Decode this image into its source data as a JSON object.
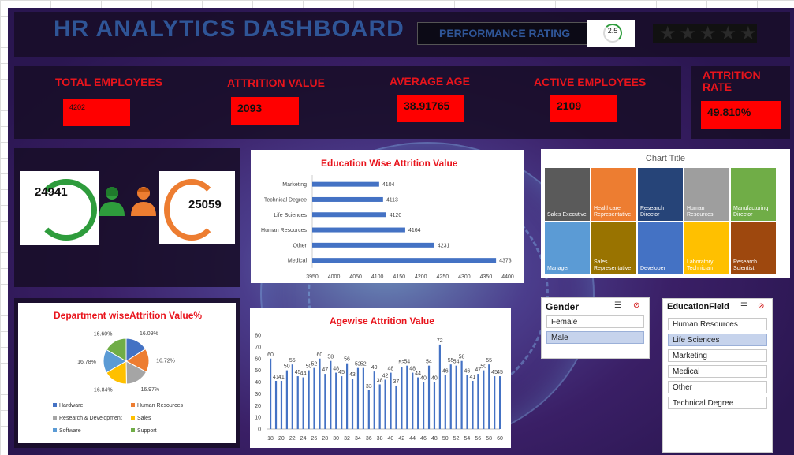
{
  "header": {
    "title": "HR  ANALYTICS   DASHBOARD",
    "performance_label": "PERFORMANCE RATING",
    "performance_value": "2.5",
    "stars": "★★★★★"
  },
  "kpis": [
    {
      "label": "TOTAL  EMPLOYEES",
      "value": "4202"
    },
    {
      "label": "ATTRITION VALUE",
      "value": "2093"
    },
    {
      "label": "AVERAGE AGE",
      "value": "38.91765"
    },
    {
      "label": "ACTIVE EMPLOYEES",
      "value": "2109"
    },
    {
      "label": "ATTRITION RATE",
      "value": "49.810%"
    }
  ],
  "gender_counts": {
    "female": "24941",
    "male": "25059"
  },
  "colors": {
    "accent_red": "#e8141c",
    "bar_blue": "#4472c4",
    "title_blue": "#2f5597",
    "green": "#2e9c3c",
    "orange": "#ed7d31"
  },
  "icons": [
    "female-person-icon",
    "male-person-icon",
    "sort-icon",
    "clear-filter-icon"
  ],
  "chart_data": [
    {
      "type": "bar",
      "orientation": "horizontal",
      "title": "Education Wise Attrition Value",
      "categories": [
        "Marketing",
        "Technical Degree",
        "Life Sciences",
        "Human Resources",
        "Other",
        "Medical"
      ],
      "values": [
        4104,
        4113,
        4120,
        4164,
        4231,
        4373
      ],
      "xlim": [
        3950,
        4400
      ],
      "xticks": [
        "3950",
        "4000",
        "4050",
        "4100",
        "4150",
        "4200",
        "4250",
        "4300",
        "4350",
        "4400"
      ]
    },
    {
      "type": "table",
      "title": "Chart Title",
      "categories": [
        "Sales Executive",
        "Healthcare Representative",
        "Research Director",
        "Human Resources",
        "Manufacturing Director",
        "Manager",
        "Sales Representative",
        "Developer",
        "Laboratory Technician",
        "Research Scientist"
      ],
      "tile_colors": [
        "#5a5a5a",
        "#ed7d31",
        "#264478",
        "#9e9e9e",
        "#70ad47",
        "#5b9bd5",
        "#997300",
        "#4472c4",
        "#ffc000",
        "#9e480e"
      ]
    },
    {
      "type": "pie",
      "title": "Department wiseAttrition Value%",
      "categories": [
        "Hardware",
        "Human Resources",
        "Research & Development",
        "Sales",
        "Software",
        "Support"
      ],
      "values": [
        16.09,
        16.72,
        16.97,
        16.84,
        16.78,
        16.6
      ],
      "labels": [
        "16.09%",
        "16.72%",
        "16.97%",
        "16.84%",
        "16.78%",
        "16.60%"
      ],
      "colors": [
        "#4472c4",
        "#ed7d31",
        "#a5a5a5",
        "#ffc000",
        "#5b9bd5",
        "#70ad47"
      ]
    },
    {
      "type": "bar",
      "title": "Agewise Attrition Value",
      "x": [
        18,
        19,
        20,
        21,
        22,
        23,
        24,
        25,
        26,
        27,
        28,
        29,
        30,
        31,
        32,
        33,
        34,
        35,
        36,
        37,
        38,
        39,
        40,
        41,
        42,
        43,
        44,
        45,
        46,
        47,
        48,
        49,
        50,
        51,
        52,
        53,
        54,
        55,
        56,
        57,
        58,
        59,
        60
      ],
      "values": [
        60,
        41,
        41,
        50,
        55,
        45,
        44,
        50,
        52,
        60,
        47,
        58,
        48,
        45,
        56,
        43,
        52,
        52,
        33,
        49,
        38,
        42,
        48,
        37,
        53,
        54,
        48,
        44,
        40,
        54,
        40,
        72,
        46,
        55,
        54,
        58,
        46,
        41,
        47,
        50,
        55,
        45,
        45
      ],
      "ylim": [
        0,
        80
      ],
      "yticks": [
        "0",
        "10",
        "20",
        "30",
        "40",
        "50",
        "60",
        "70",
        "80"
      ],
      "xticks": [
        "18",
        "20",
        "22",
        "24",
        "26",
        "28",
        "30",
        "32",
        "34",
        "36",
        "38",
        "40",
        "42",
        "44",
        "46",
        "48",
        "50",
        "52",
        "54",
        "56",
        "58",
        "60"
      ]
    }
  ],
  "slicers": {
    "gender": {
      "title": "Gender",
      "items": [
        {
          "label": "Female",
          "selected": false
        },
        {
          "label": "Male",
          "selected": true
        }
      ]
    },
    "education": {
      "title": "EducationField",
      "items": [
        {
          "label": "Human Resources",
          "selected": false
        },
        {
          "label": "Life Sciences",
          "selected": true
        },
        {
          "label": "Marketing",
          "selected": false
        },
        {
          "label": "Medical",
          "selected": false
        },
        {
          "label": "Other",
          "selected": false
        },
        {
          "label": "Technical Degree",
          "selected": false
        }
      ]
    }
  }
}
